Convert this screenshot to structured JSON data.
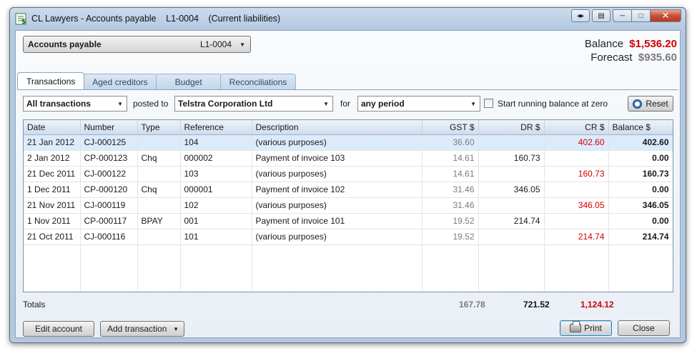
{
  "window": {
    "title_app": "CL Lawyers - Accounts payable",
    "title_code": "L1-0004",
    "title_group": "(Current liabilities)",
    "close_glyph": "✕",
    "min_glyph": "─",
    "max_glyph": "□",
    "back_forward_glyph": "◂▸",
    "list_glyph": "▤"
  },
  "account": {
    "name": "Accounts payable",
    "code": "L1-0004"
  },
  "summary": {
    "balance_label": "Balance",
    "balance_value": "$1,536.20",
    "forecast_label": "Forecast",
    "forecast_value": "$935.60"
  },
  "tabs": [
    {
      "label": "Transactions",
      "active": true
    },
    {
      "label": "Aged creditors",
      "active": false
    },
    {
      "label": "Budget",
      "active": false
    },
    {
      "label": "Reconciliations",
      "active": false
    }
  ],
  "filters": {
    "transaction_filter": "All transactions",
    "posted_to_label": "posted to",
    "contact": "Telstra Corporation Ltd",
    "for_label": "for",
    "period": "any period",
    "running_balance_label": "Start running balance at zero",
    "running_balance_checked": false,
    "reset_label": "Reset"
  },
  "table": {
    "columns": [
      "Date",
      "Number",
      "Type",
      "Reference",
      "Description",
      "GST $",
      "DR $",
      "CR $",
      "Balance $"
    ],
    "rows": [
      {
        "date": "21 Jan 2012",
        "number": "CJ-000125",
        "type": "",
        "reference": "104",
        "description": "(various purposes)",
        "gst": "36.60",
        "dr": "",
        "cr": "402.60",
        "balance": "402.60",
        "selected": true
      },
      {
        "date": "2 Jan 2012",
        "number": "CP-000123",
        "type": "Chq",
        "reference": "000002",
        "description": "Payment of invoice 103",
        "gst": "14.61",
        "dr": "160.73",
        "cr": "",
        "balance": "0.00"
      },
      {
        "date": "21 Dec 2011",
        "number": "CJ-000122",
        "type": "",
        "reference": "103",
        "description": "(various purposes)",
        "gst": "14.61",
        "dr": "",
        "cr": "160.73",
        "balance": "160.73"
      },
      {
        "date": "1 Dec 2011",
        "number": "CP-000120",
        "type": "Chq",
        "reference": "000001",
        "description": "Payment of invoice 102",
        "gst": "31.46",
        "dr": "346.05",
        "cr": "",
        "balance": "0.00"
      },
      {
        "date": "21 Nov 2011",
        "number": "CJ-000119",
        "type": "",
        "reference": "102",
        "description": "(various purposes)",
        "gst": "31.46",
        "dr": "",
        "cr": "346.05",
        "balance": "346.05"
      },
      {
        "date": "1 Nov 2011",
        "number": "CP-000117",
        "type": "BPAY",
        "reference": "001",
        "description": "Payment of invoice 101",
        "gst": "19.52",
        "dr": "214.74",
        "cr": "",
        "balance": "0.00"
      },
      {
        "date": "21 Oct 2011",
        "number": "CJ-000116",
        "type": "",
        "reference": "101",
        "description": "(various purposes)",
        "gst": "19.52",
        "dr": "",
        "cr": "214.74",
        "balance": "214.74"
      }
    ]
  },
  "totals": {
    "label": "Totals",
    "gst": "167.78",
    "dr": "721.52",
    "cr": "1,124.12"
  },
  "buttons": {
    "edit_account": "Edit account",
    "add_transaction": "Add transaction",
    "print": "Print",
    "close": "Close"
  },
  "colors": {
    "negative_red": "#d40000",
    "muted_grey": "#7b7b7b",
    "selection": "#dcebfc"
  }
}
